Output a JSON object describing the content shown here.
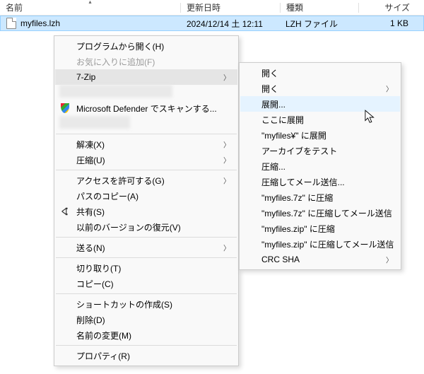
{
  "columns": {
    "name": "名前",
    "date": "更新日時",
    "kind": "種類",
    "size": "サイズ"
  },
  "file": {
    "name": "myfiles.lzh",
    "date": "2024/12/14 土 12:11",
    "kind": "LZH ファイル",
    "size": "1 KB"
  },
  "menu": {
    "open_with": "プログラムから開く(H)",
    "add_fav": "お気に入りに追加(F)",
    "sevenzip": "7-Zip",
    "defender": "Microsoft Defender でスキャンする...",
    "extract": "解凍(X)",
    "compress": "圧縮(U)",
    "grant_access": "アクセスを許可する(G)",
    "copy_path": "パスのコピー(A)",
    "share": "共有(S)",
    "restore_prev": "以前のバージョンの復元(V)",
    "send_to": "送る(N)",
    "cut": "切り取り(T)",
    "copy": "コピー(C)",
    "create_shortcut": "ショートカットの作成(S)",
    "delete": "削除(D)",
    "rename": "名前の変更(M)",
    "properties": "プロパティ(R)"
  },
  "submenu": {
    "open1": "開く",
    "open2": "開く",
    "extract": "展開...",
    "extract_here": "ここに展開",
    "extract_to": "\"myfiles¥\" に展開",
    "test_archive": "アーカイブをテスト",
    "compress": "圧縮...",
    "compress_mail": "圧縮してメール送信...",
    "to_7z": "\"myfiles.7z\" に圧縮",
    "to_7z_mail": "\"myfiles.7z\" に圧縮してメール送信",
    "to_zip": "\"myfiles.zip\" に圧縮",
    "to_zip_mail": "\"myfiles.zip\" に圧縮してメール送信",
    "crc_sha": "CRC SHA"
  }
}
